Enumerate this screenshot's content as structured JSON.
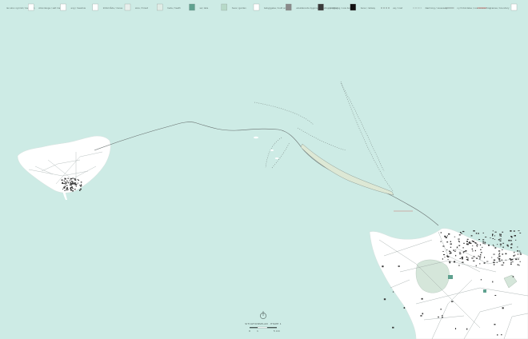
{
  "colors": {
    "sea": "#cdebe5",
    "land": "#ffffff",
    "road": "#8f9a98",
    "route": "#676f6e",
    "green_area": "#d5e6da",
    "green_dark": "#5fa18f",
    "buildings": "#333333",
    "harbor_pier": "#dde8d5",
    "red_line": "#c9534f"
  },
  "legend": {
    "items": [
      {
        "label": "lav skov og krat / low scrub",
        "icon": "dotted-box-icon"
      },
      {
        "label": "strandenge / salt marsh",
        "icon": "hatched-box-icon"
      },
      {
        "label": "eng / meadow",
        "icon": "light-box-icon"
      },
      {
        "label": "klitområde / dunes",
        "icon": "grid-box-icon"
      },
      {
        "label": "skov / forest",
        "icon": "tree-box-icon"
      },
      {
        "label": "hede / heath",
        "icon": "teal-box-icon"
      },
      {
        "label": "sø / lake",
        "icon": "pale-green-box-icon"
      },
      {
        "label": "have / garden",
        "icon": "dotted-pale-box-icon"
      },
      {
        "label": "bebyggelse / built area",
        "icon": "grey-box-icon"
      },
      {
        "label": "eksisterende bygning / existing building",
        "icon": "dark-box-icon"
      },
      {
        "label": "ny bygning / new building",
        "icon": "black-box-icon"
      },
      {
        "label": "bane / railway",
        "icon": "dashed-line-icon"
      },
      {
        "label": "vej / road",
        "icon": "dotted-line-icon"
      },
      {
        "label": "dæmning / causeway",
        "icon": "solid-line-icon"
      },
      {
        "label": "ny forbindelse / new connection",
        "icon": "red-line-icon"
      },
      {
        "label": "grænse / boundary",
        "icon": "boundary-box-icon"
      }
    ]
  },
  "title_block": {
    "title": "SITUATIONSPLAN · ETAPE 1",
    "scale_labels": [
      "0",
      "1",
      "5 km"
    ]
  },
  "icons": {
    "north_arrow": "north-arrow-icon"
  }
}
